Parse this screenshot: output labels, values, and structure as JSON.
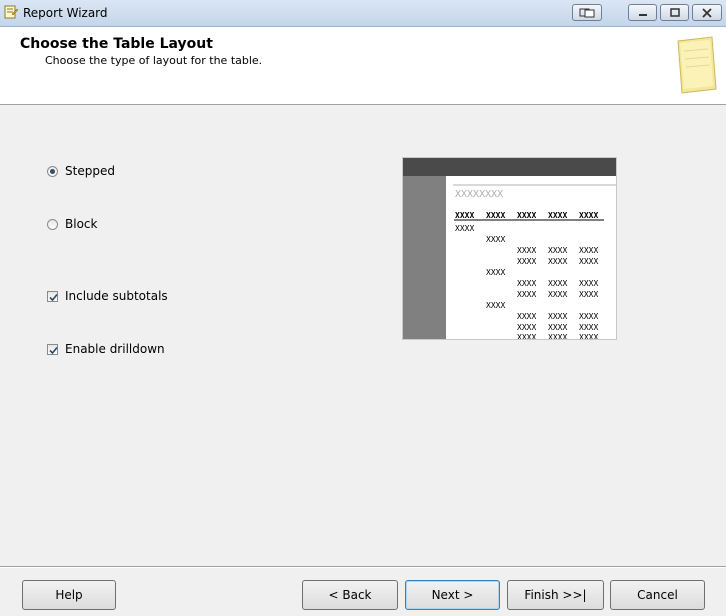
{
  "window": {
    "title": "Report Wizard"
  },
  "header": {
    "title": "Choose the Table Layout",
    "subtitle": "Choose the type of layout for the table."
  },
  "layout_options": [
    {
      "label": "Stepped",
      "selected": true
    },
    {
      "label": "Block",
      "selected": false
    }
  ],
  "checkboxes": [
    {
      "label": "Include subtotals",
      "checked": true
    },
    {
      "label": "Enable drilldown",
      "checked": true
    }
  ],
  "preview": {
    "title_placeholder": "XXXXXXXX",
    "header_cells": [
      "XXXX",
      "XXXX",
      "XXXX",
      "XXXX",
      "XXXX"
    ],
    "cell_placeholder": "XXXX"
  },
  "buttons": {
    "help": "Help",
    "back": "< Back",
    "next": "Next >",
    "finish": "Finish >>|",
    "cancel": "Cancel"
  }
}
